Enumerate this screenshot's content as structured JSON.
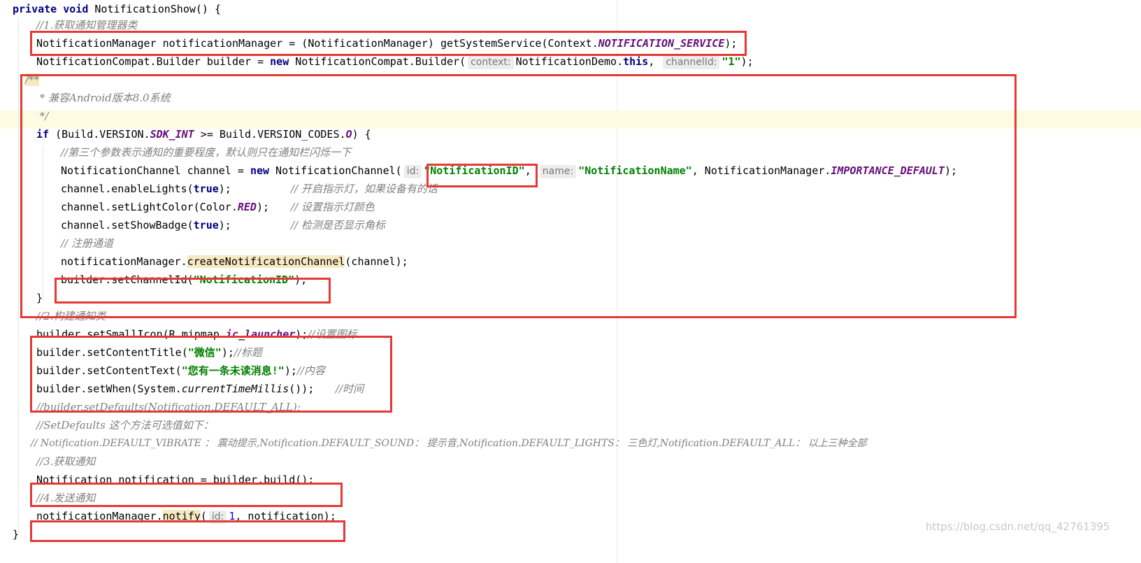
{
  "code": {
    "l1": {
      "kw1": "private",
      "kw2": "void",
      "rest": " NotificationShow() {"
    },
    "l2": "//1.获取通知管理器类",
    "l3": {
      "pre": "NotificationManager notificationManager = (NotificationManager) getSystemService(Context.",
      "field": "NOTIFICATION_SERVICE",
      "post": ");"
    },
    "l4": {
      "pre": "NotificationCompat.Builder builder = ",
      "kw": "new",
      "mid": " NotificationCompat.Builder(",
      "hint1": "context:",
      "arg1": "NotificationDemo.",
      "kw_this": "this",
      "comma": ",",
      "hint2": "channelId:",
      "arg2": "\"1\"",
      "post": ");"
    },
    "l5": "/**",
    "l6": " * 兼容Android版本8.0系统",
    "l7": " */",
    "l8": {
      "kw": "if",
      "pre": " (Build.VERSION.",
      "field": "SDK_INT",
      "mid": " >= Build.VERSION_CODES.",
      "field2": "O",
      "post": ") {"
    },
    "l9": "//第三个参数表示通知的重要程度，默认则只在通知栏闪烁一下",
    "l10": {
      "pre": "NotificationChannel channel = ",
      "kw": "new",
      "mid": " NotificationChannel(",
      "hint1": "id:",
      "arg1": "\"NotificationID\"",
      "comma": ",",
      "hint2": "name:",
      "arg2": "\"NotificationName\"",
      "mid2": ", NotificationManager.",
      "field": "IMPORTANCE_DEFAULT",
      "post": ");"
    },
    "l11": {
      "pre": "channel.enableLights(",
      "kw": "true",
      "post": ");",
      "comment": "// 开启指示灯，如果设备有的话"
    },
    "l12": {
      "pre": "channel.setLightColor(Color.",
      "field": "RED",
      "post": ");",
      "comment": "// 设置指示灯颜色"
    },
    "l13": {
      "pre": "channel.setShowBadge(",
      "kw": "true",
      "post": ");",
      "comment": "// 检测是否显示角标"
    },
    "l14": "// 注册通道",
    "l15": {
      "pre": "notificationManager.",
      "method": "createNotificationChannel",
      "post": "(channel);"
    },
    "l16": {
      "pre": "builder.setChannelId(",
      "arg": "\"NotificationID\"",
      "post": ");"
    },
    "l17": "}",
    "l18": "//2.构建通知类",
    "l19": {
      "pre": "builder.setSmallIcon(R.mipmap.",
      "field": "ic_launcher",
      "post": ");",
      "comment": "//设置图标"
    },
    "l20": {
      "pre": "builder.setContentTitle(",
      "arg": "\"微信\"",
      "post": ");",
      "comment": "//标题"
    },
    "l21": {
      "pre": "builder.setContentText(",
      "arg": "\"您有一条未读消息!\"",
      "post": ");",
      "comment": "//内容"
    },
    "l22": {
      "pre": "builder.setWhen(System.",
      "method": "currentTimeMillis",
      "post": "());",
      "comment": "//时间"
    },
    "l23": "//builder.setDefaults(Notification.DEFAULT_ALL);",
    "l24": "//SetDefaults 这个方法可选值如下：",
    "l25": "// Notification.DEFAULT_VIBRATE ： 震动提示,Notification.DEFAULT_SOUND： 提示音,Notification.DEFAULT_LIGHTS： 三色灯,Notification.DEFAULT_ALL： 以上三种全部",
    "l26": "//3.获取通知",
    "l27": "Notification notification = builder.build();",
    "l28": "//4.发送通知",
    "l29": {
      "pre": "notificationManager.",
      "method": "notify",
      "open": "(",
      "hint": "id:",
      "num": "1",
      "post": ", notification);"
    },
    "l30": "}"
  },
  "watermark": "https://blog.csdn.net/qq_42761395",
  "colors": {
    "annotation": "#e53935",
    "keyword": "#000080",
    "string": "#008000",
    "static_field": "#660e7a",
    "comment": "#808080"
  }
}
